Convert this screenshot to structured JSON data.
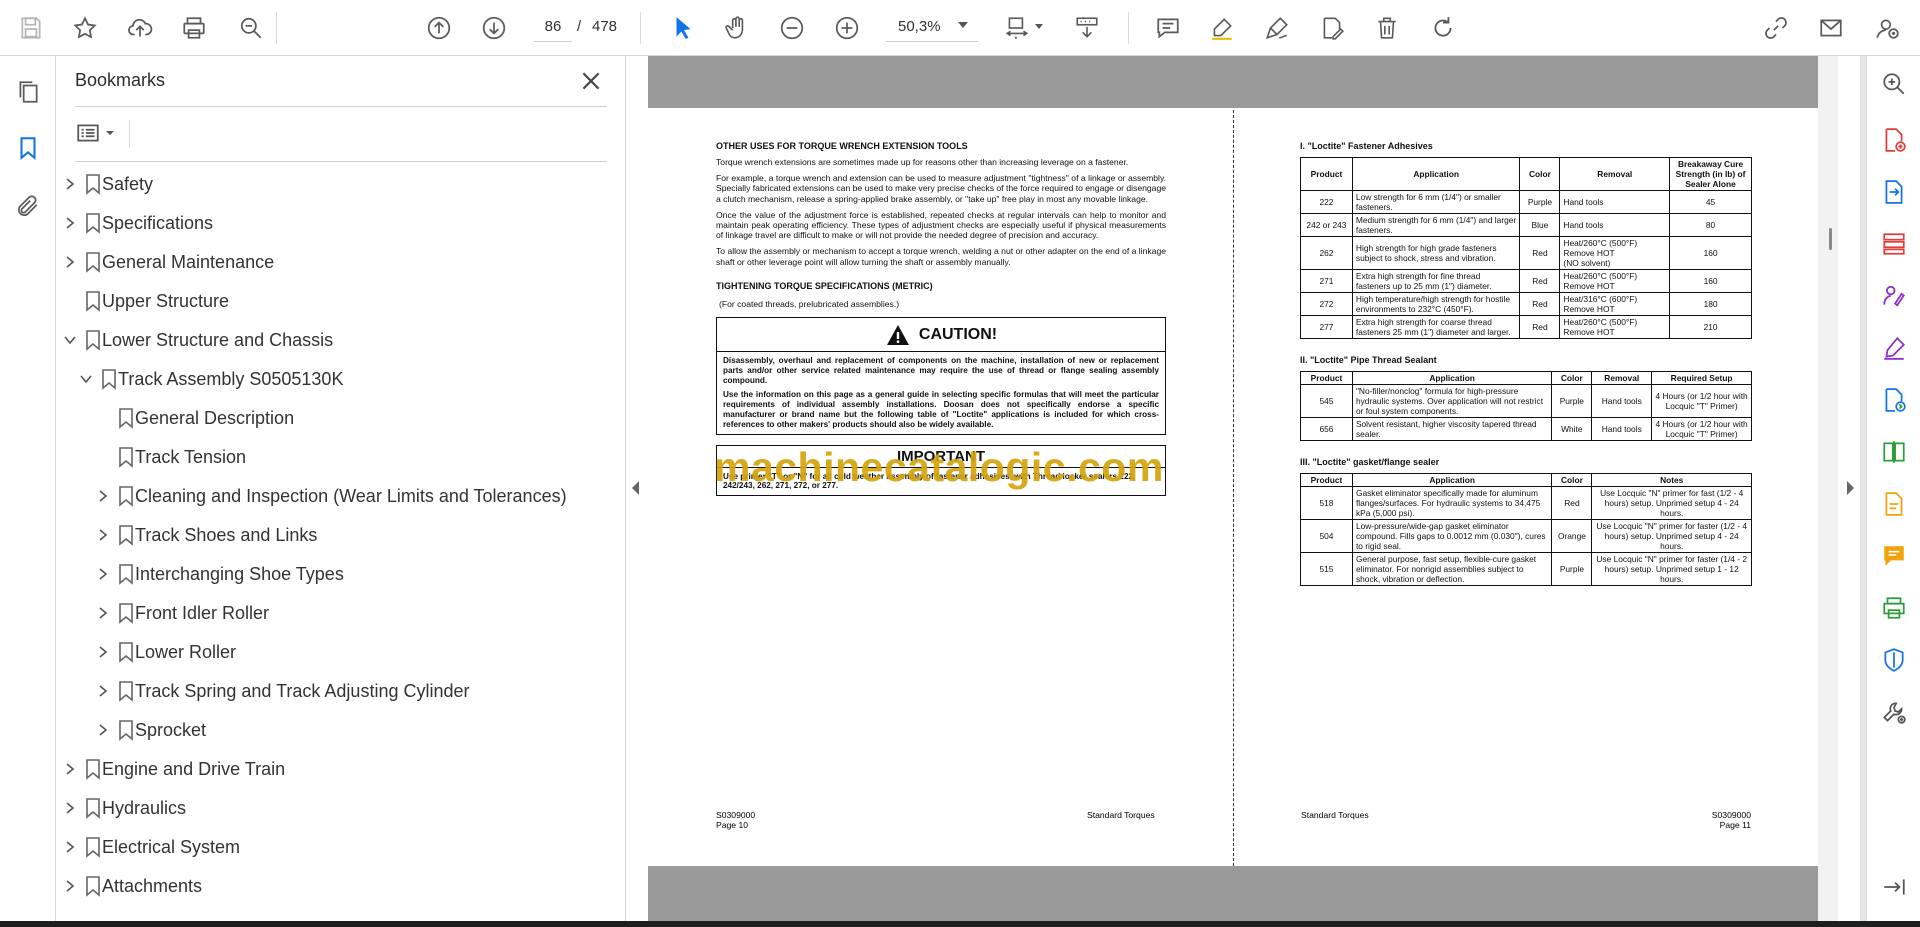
{
  "toolbar": {
    "current_page": "86",
    "page_separator": "/",
    "total_pages": "478",
    "zoom": "50,3%"
  },
  "bookmarks": {
    "title": "Bookmarks",
    "items": [
      {
        "label": "Safety",
        "level": 0,
        "expand": "collapsed"
      },
      {
        "label": "Specifications",
        "level": 0,
        "expand": "collapsed"
      },
      {
        "label": "General Maintenance",
        "level": 0,
        "expand": "collapsed"
      },
      {
        "label": "Upper Structure",
        "level": 0,
        "expand": "none"
      },
      {
        "label": "Lower Structure and Chassis",
        "level": 0,
        "expand": "expanded"
      },
      {
        "label": "Track Assembly S0505130K",
        "level": 1,
        "expand": "expanded"
      },
      {
        "label": "General Description",
        "level": 2,
        "expand": "none"
      },
      {
        "label": "Track Tension",
        "level": 2,
        "expand": "none"
      },
      {
        "label": "Cleaning and Inspection (Wear Limits and Tolerances)",
        "level": 2,
        "expand": "collapsed"
      },
      {
        "label": "Track Shoes and Links",
        "level": 2,
        "expand": "collapsed"
      },
      {
        "label": "Interchanging Shoe Types",
        "level": 2,
        "expand": "collapsed"
      },
      {
        "label": "Front Idler Roller",
        "level": 2,
        "expand": "collapsed"
      },
      {
        "label": "Lower Roller",
        "level": 2,
        "expand": "collapsed"
      },
      {
        "label": "Track Spring and Track Adjusting Cylinder",
        "level": 2,
        "expand": "collapsed"
      },
      {
        "label": "Sprocket",
        "level": 2,
        "expand": "collapsed"
      },
      {
        "label": "Engine and Drive Train",
        "level": 0,
        "expand": "collapsed"
      },
      {
        "label": "Hydraulics",
        "level": 0,
        "expand": "collapsed"
      },
      {
        "label": "Electrical System",
        "level": 0,
        "expand": "collapsed"
      },
      {
        "label": "Attachments",
        "level": 0,
        "expand": "collapsed"
      }
    ]
  },
  "page_left": {
    "heading1": "OTHER USES FOR TORQUE WRENCH EXTENSION TOOLS",
    "p1": "Torque wrench extensions are sometimes made up for reasons other than increasing leverage on a fastener.",
    "p2": "For example, a torque wrench and extension can be used to measure adjustment \"tightness\" of a linkage or assembly. Specially fabricated extensions can be used to make very precise checks of the force required to engage or disengage a clutch mechanism, release a spring-applied brake assembly, or \"take up\" free play in most any movable linkage.",
    "p3": "Once the value of the adjustment force is established, repeated checks at regular intervals can help to monitor and maintain peak operating efficiency. These types of adjustment checks are especially useful if physical measurements of linkage travel are difficult to make or will not provide the needed degree of precision and accuracy.",
    "p4": "To allow the assembly or mechanism to accept a torque wrench, welding a nut or other adapter on the end of a linkage shaft or other leverage point will allow turning the shaft or assembly manually.",
    "heading2": "TIGHTENING TORQUE SPECIFICATIONS (METRIC)",
    "subnote": "(For coated threads, prelubricated assemblies.)",
    "caution_title": "CAUTION!",
    "caution_p1": "Disassembly, overhaul and replacement of components on the machine, installation of new or replacement parts and/or other service related maintenance may require the use of thread or flange sealing assembly compound.",
    "caution_p2": "Use the information on this page as a general guide in selecting specific formulas that will meet the particular requirements of individual assembly installations. Doosan does not specifically endorse a specific manufacturer or brand name but the following table of \"Loctite\" applications is included for which cross-references to other makers' products should also be widely available.",
    "important_title": "IMPORTANT",
    "important_text": "Use primer \"T\" or \"N\" for all cold weather assembly of fastener adhesives, with Thread locker sealers 222, 242/243, 262, 271, 272, or 277.",
    "footer_code": "S0309000",
    "footer_page": "Page 10",
    "footer_title": "Standard Torques"
  },
  "page_right": {
    "table1_title": "I. \"Loctite\" Fastener Adhesives",
    "table1_headers": [
      "Product",
      "Application",
      "Color",
      "Removal",
      "Breakaway Cure Strength (in lb) of Sealer Alone"
    ],
    "table1_rows": [
      [
        "222",
        "Low strength for 6 mm (1/4\") or smaller fasteners.",
        "Purple",
        "Hand tools",
        "45"
      ],
      [
        "242 or 243",
        "Medium strength for 6 mm (1/4\") and larger fasteners.",
        "Blue",
        "Hand tools",
        "80"
      ],
      [
        "262",
        "High strength for high grade fasteners subject to shock, stress and vibration.",
        "Red",
        "Heat/260°C (500°F) Remove HOT\n(NO solvent)",
        "160"
      ],
      [
        "271",
        "Extra high strength for fine thread fasteners up to 25 mm (1\") diameter.",
        "Red",
        "Heat/260°C (500°F) Remove HOT",
        "160"
      ],
      [
        "272",
        "High temperature/high strength for hostile environments to 232°C (450°F).",
        "Red",
        "Heat/316°C (600°F) Remove HOT",
        "180"
      ],
      [
        "277",
        "Extra high strength for coarse thread fasteners 25 mm (1\") diameter and larger.",
        "Red",
        "Heat/260°C (500°F) Remove HOT",
        "210"
      ]
    ],
    "table2_title": "II. \"Loctite\" Pipe Thread Sealant",
    "table2_headers": [
      "Product",
      "Application",
      "Color",
      "Removal",
      "Required Setup"
    ],
    "table2_rows": [
      [
        "545",
        "\"No-filler/nonclog\" formula for high-pressure hydraulic systems. Over application will not restrict or foul system components.",
        "Purple",
        "Hand tools",
        "4 Hours (or 1/2 hour with Locquic \"T\" Primer)"
      ],
      [
        "656",
        "Solvent resistant, higher viscosity tapered thread sealer.",
        "White",
        "Hand tools",
        "4 Hours (or 1/2 hour with Locquic \"T\" Primer)"
      ]
    ],
    "table3_title": "III. \"Loctite\" gasket/flange sealer",
    "table3_headers": [
      "Product",
      "Application",
      "Color",
      "Notes"
    ],
    "table3_rows": [
      [
        "518",
        "Gasket eliminator specifically made for aluminum flanges/surfaces. For hydraulic systems to 34,475 kPa (5,000 psi).",
        "Red",
        "Use Locquic \"N\" primer for fast (1/2 - 4 hours) setup. Unprimed setup 4 - 24 hours."
      ],
      [
        "504",
        "Low-pressure/wide-gap gasket eliminator compound. Fills gaps to 0.0012 mm (0.030\"), cures to rigid seal.",
        "Orange",
        "Use Locquic \"N\" primer for faster (1/2 - 4 hours) setup. Unprimed setup 4 - 24 hours."
      ],
      [
        "515",
        "General purpose, fast setup, flexible-cure gasket eliminator. For nonrigid assemblies subject to shock, vibration or deflection.",
        "Purple",
        "Use Locquic \"N\" primer for faster (1/4 - 2 hours) setup. Unprimed setup 1 - 12 hours."
      ]
    ],
    "footer_title": "Standard Torques",
    "footer_code": "S0309000",
    "footer_page": "Page 11"
  },
  "watermark": "machinecatalogic.com",
  "colors": {
    "accent_blue": "#1473e6",
    "watermark": "#d4a40a",
    "rail_red": "#e03c3c",
    "rail_purple": "#8b2bc9",
    "rail_green": "#2d9d3a",
    "rail_yellow": "#f0a30a"
  }
}
